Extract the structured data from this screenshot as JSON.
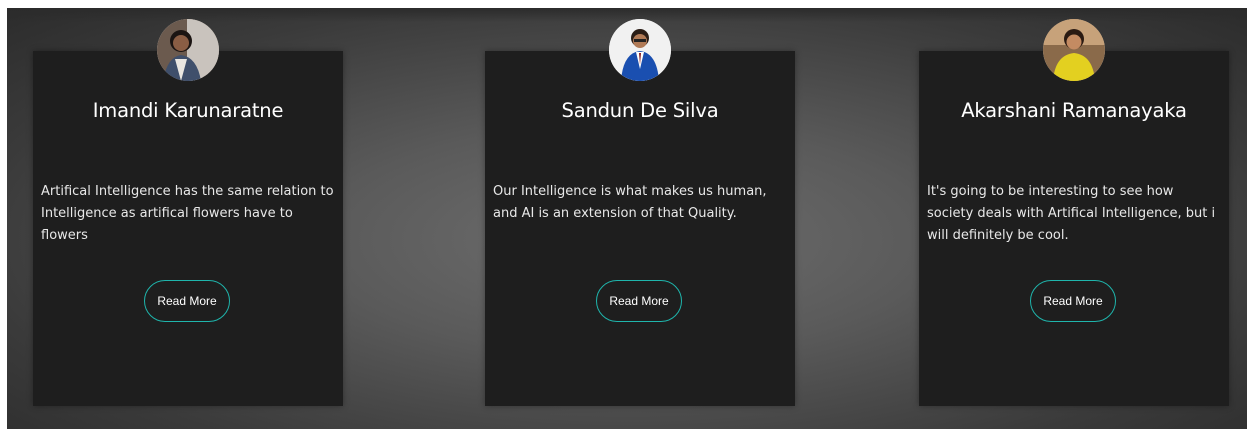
{
  "cards": [
    {
      "name": "Imandi Karunaratne",
      "quote": "Artifical Intelligence has the same relation to Intelligence as artifical flowers have to flowers",
      "button_label": "Read More",
      "avatar_icon": "person-photo-avatar"
    },
    {
      "name": "Sandun De Silva",
      "quote": "Our Intelligence is what makes us human, and AI is an extension of that Quality.",
      "button_label": "Read More",
      "avatar_icon": "person-photo-avatar"
    },
    {
      "name": "Akarshani Ramanayaka",
      "quote": "It's going to be interesting to see how society deals with Artifical Intelligence, but i will definitely be cool.",
      "button_label": "Read More",
      "avatar_icon": "person-photo-avatar"
    }
  ],
  "colors": {
    "card_bg": "#1e1e1e",
    "button_border": "#1fb5ac",
    "text": "#ffffff"
  }
}
